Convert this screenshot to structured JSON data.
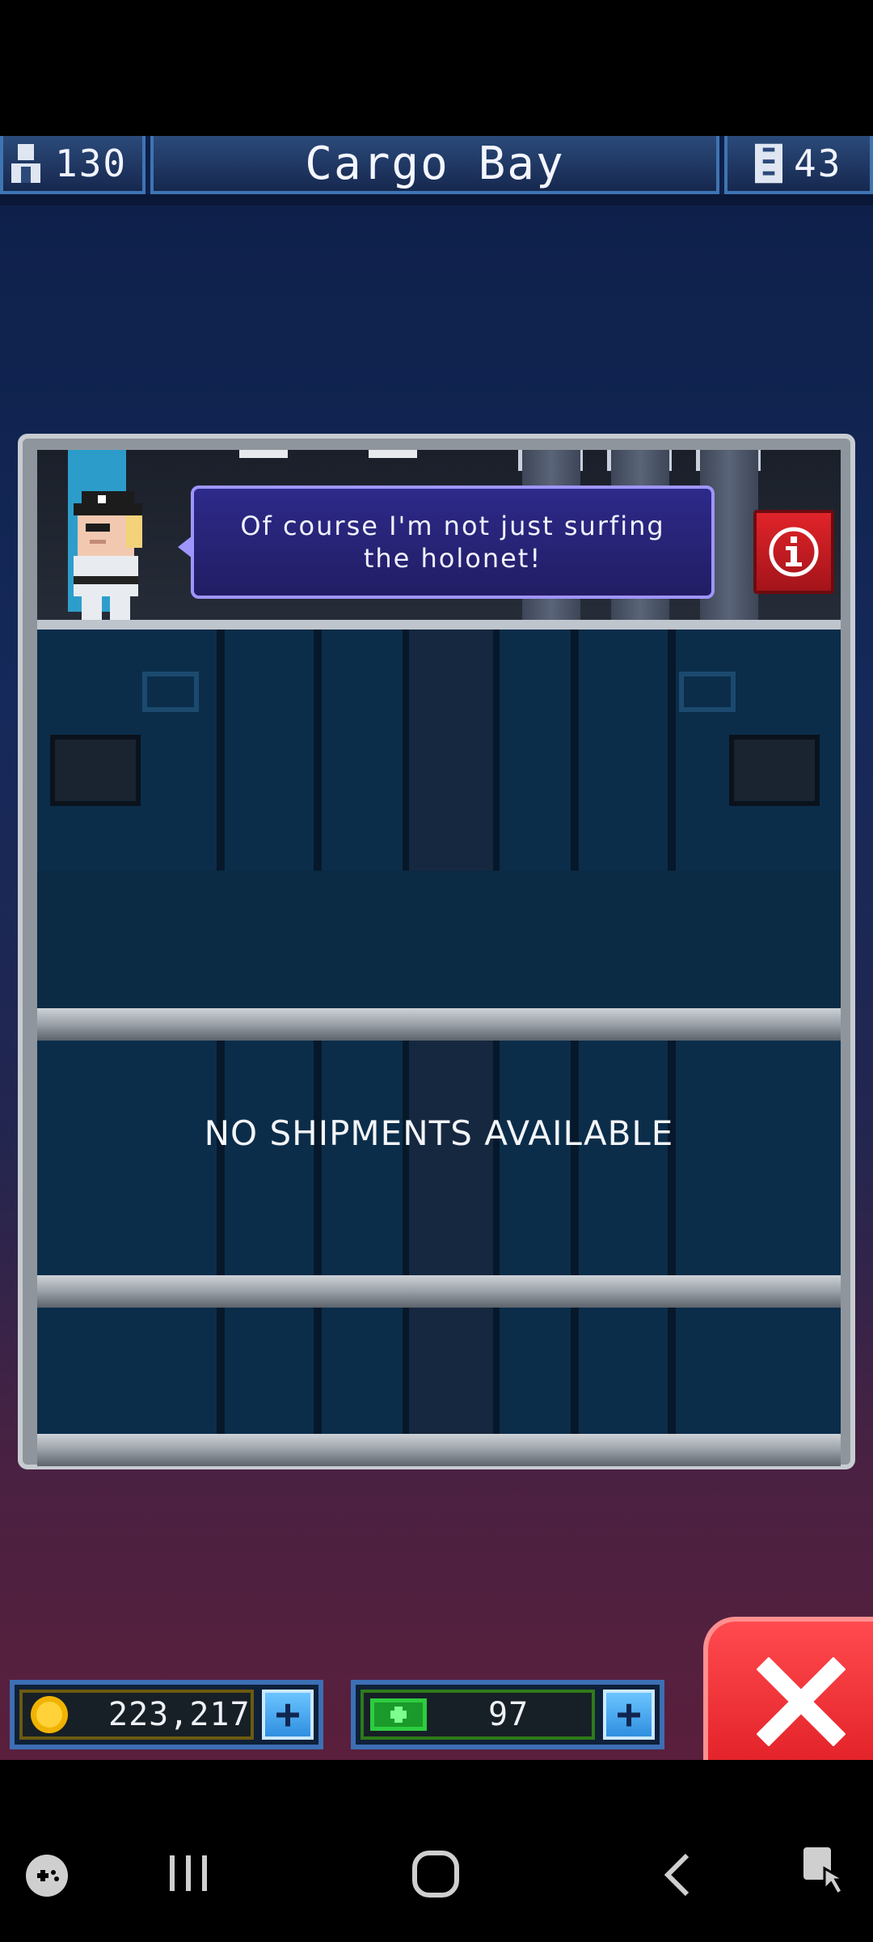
{
  "topbar": {
    "population": "130",
    "title": "Cargo Bay",
    "floors": "43",
    "icons": [
      "person-icon",
      "tower-icon"
    ]
  },
  "cargo": {
    "speech": "Of course I'm not just surfing the holonet!",
    "empty_message": "NO SHIPMENTS AVAILABLE",
    "info_button_icon": "info-icon"
  },
  "currency": {
    "coins": "223,217",
    "bux": "97",
    "coin_icon": "coin-icon",
    "bux_icon": "bux-icon",
    "add_icon": "plus-icon"
  },
  "close_icon": "close-x-icon",
  "navbar": {
    "icons": [
      "game-launcher-icon",
      "recents-icon",
      "home-icon",
      "back-icon",
      "accessibility-icon"
    ]
  },
  "colors": {
    "accent_blue": "#3d6fb4",
    "close_red": "#e12026",
    "speech_purple": "#2d2a8a"
  }
}
